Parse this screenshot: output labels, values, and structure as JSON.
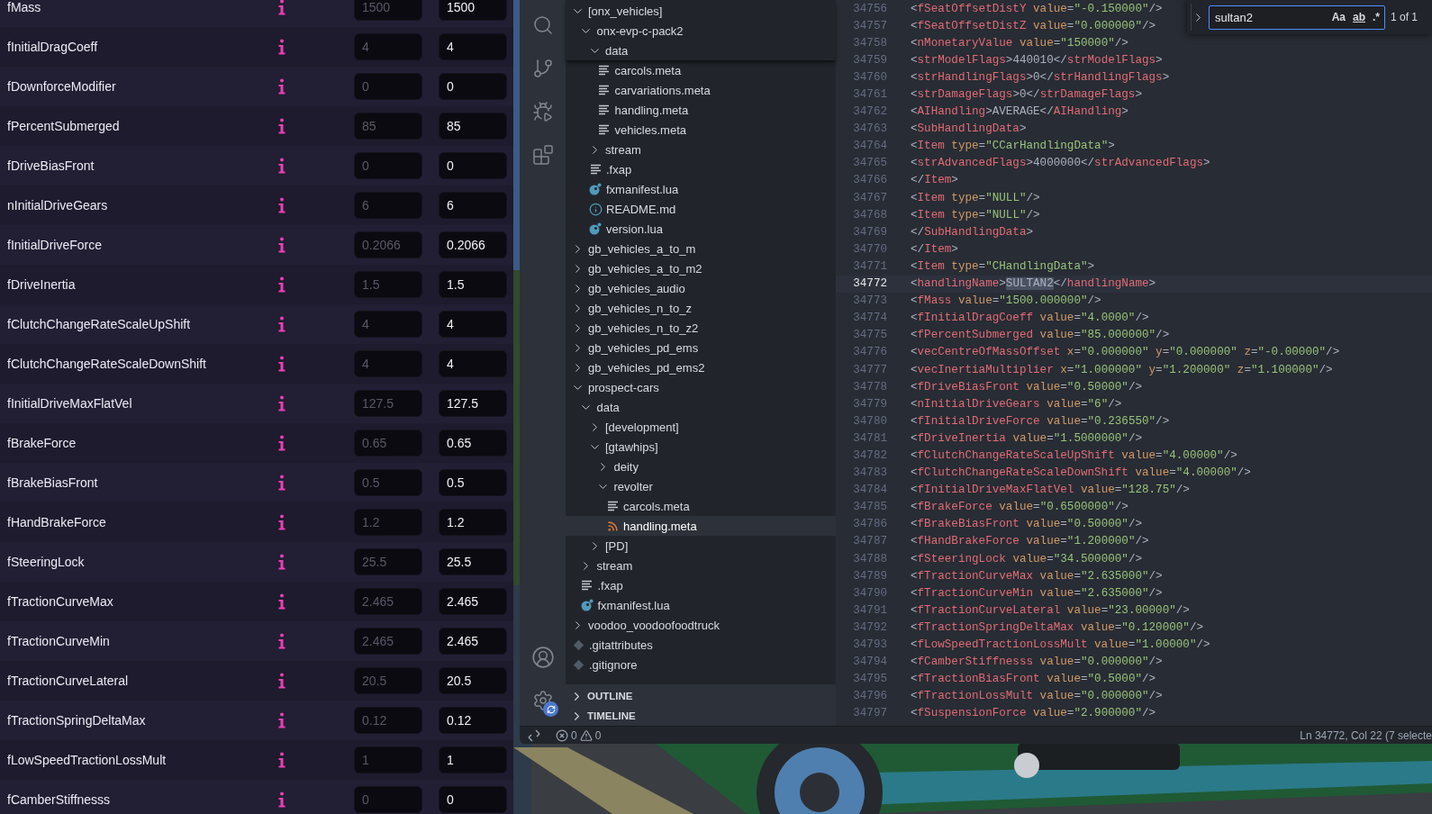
{
  "handling_panel": {
    "rows": [
      {
        "name": "fMass",
        "placeholder": "1500",
        "value": "1500"
      },
      {
        "name": "fInitialDragCoeff",
        "placeholder": "4",
        "value": "4"
      },
      {
        "name": "fDownforceModifier",
        "placeholder": "0",
        "value": "0"
      },
      {
        "name": "fPercentSubmerged",
        "placeholder": "85",
        "value": "85"
      },
      {
        "name": "fDriveBiasFront",
        "placeholder": "0",
        "value": "0"
      },
      {
        "name": "nInitialDriveGears",
        "placeholder": "6",
        "value": "6"
      },
      {
        "name": "fInitialDriveForce",
        "placeholder": "0.2066",
        "value": "0.2066"
      },
      {
        "name": "fDriveInertia",
        "placeholder": "1.5",
        "value": "1.5"
      },
      {
        "name": "fClutchChangeRateScaleUpShift",
        "placeholder": "4",
        "value": "4"
      },
      {
        "name": "fClutchChangeRateScaleDownShift",
        "placeholder": "4",
        "value": "4"
      },
      {
        "name": "fInitialDriveMaxFlatVel",
        "placeholder": "127.5",
        "value": "127.5"
      },
      {
        "name": "fBrakeForce",
        "placeholder": "0.65",
        "value": "0.65"
      },
      {
        "name": "fBrakeBiasFront",
        "placeholder": "0.5",
        "value": "0.5"
      },
      {
        "name": "fHandBrakeForce",
        "placeholder": "1.2",
        "value": "1.2"
      },
      {
        "name": "fSteeringLock",
        "placeholder": "25.5",
        "value": "25.5"
      },
      {
        "name": "fTractionCurveMax",
        "placeholder": "2.465",
        "value": "2.465"
      },
      {
        "name": "fTractionCurveMin",
        "placeholder": "2.465",
        "value": "2.465"
      },
      {
        "name": "fTractionCurveLateral",
        "placeholder": "20.5",
        "value": "20.5"
      },
      {
        "name": "fTractionSpringDeltaMax",
        "placeholder": "0.12",
        "value": "0.12"
      },
      {
        "name": "fLowSpeedTractionLossMult",
        "placeholder": "1",
        "value": "1"
      },
      {
        "name": "fCamberStiffnesss",
        "placeholder": "0",
        "value": "0"
      }
    ]
  },
  "explorer": {
    "tree": [
      {
        "label": "[onx_vehicles]",
        "kind": "folder",
        "expanded": true,
        "selected": false,
        "children": [
          {
            "label": "onx-evp-c-pack2",
            "kind": "folder",
            "expanded": true,
            "selected": false,
            "children": [
              {
                "label": "data",
                "kind": "folder",
                "expanded": true,
                "selected": false,
                "children": [
                  {
                    "label": "carcols.meta",
                    "kind": "lines",
                    "selected": false
                  },
                  {
                    "label": "carvariations.meta",
                    "kind": "lines",
                    "selected": false
                  },
                  {
                    "label": "handling.meta",
                    "kind": "lines",
                    "selected": false
                  },
                  {
                    "label": "vehicles.meta",
                    "kind": "lines",
                    "selected": false
                  }
                ]
              },
              {
                "label": "stream",
                "kind": "folder",
                "expanded": false,
                "selected": false
              },
              {
                "label": ".fxap",
                "kind": "lines",
                "selected": false
              },
              {
                "label": "fxmanifest.lua",
                "kind": "lua",
                "selected": false
              },
              {
                "label": "README.md",
                "kind": "info",
                "selected": false
              },
              {
                "label": "version.lua",
                "kind": "lua",
                "selected": false
              }
            ]
          }
        ]
      },
      {
        "label": "gb_vehicles_a_to_m",
        "kind": "folder",
        "expanded": false,
        "selected": false
      },
      {
        "label": "gb_vehicles_a_to_m2",
        "kind": "folder",
        "expanded": false,
        "selected": false
      },
      {
        "label": "gb_vehicles_audio",
        "kind": "folder",
        "expanded": false,
        "selected": false
      },
      {
        "label": "gb_vehicles_n_to_z",
        "kind": "folder",
        "expanded": false,
        "selected": false
      },
      {
        "label": "gb_vehicles_n_to_z2",
        "kind": "folder",
        "expanded": false,
        "selected": false
      },
      {
        "label": "gb_vehicles_pd_ems",
        "kind": "folder",
        "expanded": false,
        "selected": false
      },
      {
        "label": "gb_vehicles_pd_ems2",
        "kind": "folder",
        "expanded": false,
        "selected": false
      },
      {
        "label": "prospect-cars",
        "kind": "folder",
        "expanded": true,
        "selected": false,
        "children": [
          {
            "label": "data",
            "kind": "folder",
            "expanded": true,
            "selected": false,
            "children": [
              {
                "label": "[development]",
                "kind": "folder",
                "expanded": false,
                "selected": false
              },
              {
                "label": "[gtawhips]",
                "kind": "folder",
                "expanded": true,
                "selected": false,
                "children": [
                  {
                    "label": "deity",
                    "kind": "folder",
                    "expanded": false,
                    "selected": false
                  },
                  {
                    "label": "revolter",
                    "kind": "folder",
                    "expanded": true,
                    "selected": false,
                    "children": [
                      {
                        "label": "carcols.meta",
                        "kind": "lines",
                        "selected": false
                      },
                      {
                        "label": "handling.meta",
                        "kind": "rss",
                        "selected": true
                      }
                    ]
                  }
                ]
              },
              {
                "label": "[PD]",
                "kind": "folder",
                "expanded": false,
                "selected": false
              }
            ]
          },
          {
            "label": "stream",
            "kind": "folder",
            "expanded": false,
            "selected": false
          },
          {
            "label": ".fxap",
            "kind": "lines",
            "selected": false
          },
          {
            "label": "fxmanifest.lua",
            "kind": "lua",
            "selected": false
          }
        ]
      },
      {
        "label": "voodoo_voodoofoodtruck",
        "kind": "folder",
        "expanded": false,
        "selected": false
      },
      {
        "label": ".gitattributes",
        "kind": "git",
        "selected": false
      },
      {
        "label": ".gitignore",
        "kind": "git",
        "selected": false
      }
    ],
    "sections": [
      {
        "label": "OUTLINE",
        "expanded": false
      },
      {
        "label": "TIMELINE",
        "expanded": false
      }
    ]
  },
  "editor": {
    "lines": [
      {
        "number": "34756",
        "current": false,
        "code": [
          {
            "text": "<fSeatOffsetDistY value=\"-0.150000\"/>",
            "match": false
          }
        ]
      },
      {
        "number": "34757",
        "current": false,
        "code": [
          {
            "text": "<fSeatOffsetDistZ value=\"0.000000\"/>",
            "match": false
          }
        ]
      },
      {
        "number": "34758",
        "current": false,
        "code": [
          {
            "text": "<nMonetaryValue value=\"150000\"/>",
            "match": false
          }
        ]
      },
      {
        "number": "34759",
        "current": false,
        "code": [
          {
            "text": "<strModelFlags>440010</strModelFlags>",
            "match": false
          }
        ]
      },
      {
        "number": "34760",
        "current": false,
        "code": [
          {
            "text": "<strHandlingFlags>0</strHandlingFlags>",
            "match": false
          }
        ]
      },
      {
        "number": "34761",
        "current": false,
        "code": [
          {
            "text": "<strDamageFlags>0</strDamageFlags>",
            "match": false
          }
        ]
      },
      {
        "number": "34762",
        "current": false,
        "code": [
          {
            "text": "<AIHandling>AVERAGE</AIHandling>",
            "match": false
          }
        ]
      },
      {
        "number": "34763",
        "current": false,
        "code": [
          {
            "text": "<SubHandlingData>",
            "match": false
          }
        ]
      },
      {
        "number": "34764",
        "current": false,
        "code": [
          {
            "text": "<Item type=\"CCarHandlingData\">",
            "match": false
          }
        ]
      },
      {
        "number": "34765",
        "current": false,
        "code": [
          {
            "text": "<strAdvancedFlags>4000000</strAdvancedFlags>",
            "match": false
          }
        ]
      },
      {
        "number": "34766",
        "current": false,
        "code": [
          {
            "text": "</Item>",
            "match": false
          }
        ]
      },
      {
        "number": "34767",
        "current": false,
        "code": [
          {
            "text": "<Item type=\"NULL\"/>",
            "match": false
          }
        ]
      },
      {
        "number": "34768",
        "current": false,
        "code": [
          {
            "text": "<Item type=\"NULL\"/>",
            "match": false
          }
        ]
      },
      {
        "number": "34769",
        "current": false,
        "code": [
          {
            "text": "</SubHandlingData>",
            "match": false
          }
        ]
      },
      {
        "number": "34770",
        "current": false,
        "code": [
          {
            "text": "</Item>",
            "match": false
          }
        ]
      },
      {
        "number": "34771",
        "current": false,
        "code": [
          {
            "text": "<Item type=\"CHandlingData\">",
            "match": false
          }
        ]
      },
      {
        "number": "34772",
        "current": true,
        "code": [
          {
            "text": "<handlingName>",
            "match": false
          },
          {
            "text": "SULTAN2",
            "match": true
          },
          {
            "text": "</handlingName>",
            "match": false
          }
        ]
      },
      {
        "number": "34773",
        "current": false,
        "code": [
          {
            "text": "<fMass value=\"1500.000000\"/>",
            "match": false
          }
        ]
      },
      {
        "number": "34774",
        "current": false,
        "code": [
          {
            "text": "<fInitialDragCoeff value=\"4.0000\"/>",
            "match": false
          }
        ]
      },
      {
        "number": "34775",
        "current": false,
        "code": [
          {
            "text": "<fPercentSubmerged value=\"85.000000\"/>",
            "match": false
          }
        ]
      },
      {
        "number": "34776",
        "current": false,
        "code": [
          {
            "text": "<vecCentreOfMassOffset x=\"0.000000\" y=\"0.000000\" z=\"-0.00000\"/>",
            "match": false
          }
        ]
      },
      {
        "number": "34777",
        "current": false,
        "code": [
          {
            "text": "<vecInertiaMultiplier x=\"1.000000\" y=\"1.200000\" z=\"1.100000\"/>",
            "match": false
          }
        ]
      },
      {
        "number": "34778",
        "current": false,
        "code": [
          {
            "text": "<fDriveBiasFront value=\"0.50000\"/>",
            "match": false
          }
        ]
      },
      {
        "number": "34779",
        "current": false,
        "code": [
          {
            "text": "<nInitialDriveGears value=\"6\"/>",
            "match": false
          }
        ]
      },
      {
        "number": "34780",
        "current": false,
        "code": [
          {
            "text": "<fInitialDriveForce value=\"0.236550\"/>",
            "match": false
          }
        ]
      },
      {
        "number": "34781",
        "current": false,
        "code": [
          {
            "text": "<fDriveInertia value=\"1.5000000\"/>",
            "match": false
          }
        ]
      },
      {
        "number": "34782",
        "current": false,
        "code": [
          {
            "text": "<fClutchChangeRateScaleUpShift value=\"4.00000\"/>",
            "match": false
          }
        ]
      },
      {
        "number": "34783",
        "current": false,
        "code": [
          {
            "text": "<fClutchChangeRateScaleDownShift value=\"4.00000\"/>",
            "match": false
          }
        ]
      },
      {
        "number": "34784",
        "current": false,
        "code": [
          {
            "text": "<fInitialDriveMaxFlatVel value=\"128.75\"/>",
            "match": false
          }
        ]
      },
      {
        "number": "34785",
        "current": false,
        "code": [
          {
            "text": "<fBrakeForce value=\"0.6500000\"/>",
            "match": false
          }
        ]
      },
      {
        "number": "34786",
        "current": false,
        "code": [
          {
            "text": "<fBrakeBiasFront value=\"0.50000\"/>",
            "match": false
          }
        ]
      },
      {
        "number": "34787",
        "current": false,
        "code": [
          {
            "text": "<fHandBrakeForce value=\"1.200000\"/>",
            "match": false
          }
        ]
      },
      {
        "number": "34788",
        "current": false,
        "code": [
          {
            "text": "<fSteeringLock value=\"34.500000\"/>",
            "match": false
          }
        ]
      },
      {
        "number": "34789",
        "current": false,
        "code": [
          {
            "text": "<fTractionCurveMax value=\"2.635000\"/>",
            "match": false
          }
        ]
      },
      {
        "number": "34790",
        "current": false,
        "code": [
          {
            "text": "<fTractionCurveMin value=\"2.635000\"/>",
            "match": false
          }
        ]
      },
      {
        "number": "34791",
        "current": false,
        "code": [
          {
            "text": "<fTractionCurveLateral value=\"23.00000\"/>",
            "match": false
          }
        ]
      },
      {
        "number": "34792",
        "current": false,
        "code": [
          {
            "text": "<fTractionSpringDeltaMax value=\"0.120000\"/>",
            "match": false
          }
        ]
      },
      {
        "number": "34793",
        "current": false,
        "code": [
          {
            "text": "<fLowSpeedTractionLossMult value=\"1.00000\"/>",
            "match": false
          }
        ]
      },
      {
        "number": "34794",
        "current": false,
        "code": [
          {
            "text": "<fCamberStiffnesss value=\"0.000000\"/>",
            "match": false
          }
        ]
      },
      {
        "number": "34795",
        "current": false,
        "code": [
          {
            "text": "<fTractionBiasFront value=\"0.5000\"/>",
            "match": false
          }
        ]
      },
      {
        "number": "34796",
        "current": false,
        "code": [
          {
            "text": "<fTractionLossMult value=\"0.000000\"/>",
            "match": false
          }
        ]
      },
      {
        "number": "34797",
        "current": false,
        "code": [
          {
            "text": "<fSuspensionForce value=\"2.900000\"/>",
            "match": false
          }
        ]
      }
    ],
    "find": {
      "value": "sultan2",
      "options": [
        {
          "kind": "case",
          "label": "Aa",
          "selected": false
        },
        {
          "kind": "word",
          "label": "ab",
          "selected": false
        },
        {
          "kind": "regex",
          "label": ".*",
          "selected": false
        }
      ],
      "result": "1 of 1"
    }
  },
  "status_bar": {
    "errors": "0",
    "warnings": "0",
    "position": "Ln 34772, Col 22 (7 selecte"
  }
}
